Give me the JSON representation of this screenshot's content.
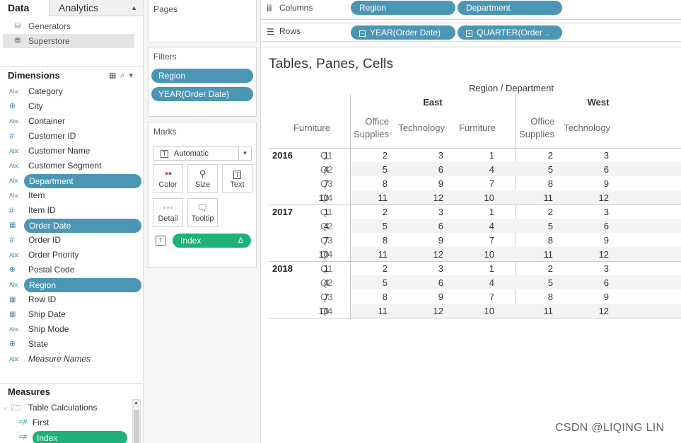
{
  "tabs": {
    "data": "Data",
    "analytics": "Analytics"
  },
  "sources": [
    {
      "label": "Generators",
      "icon": "cylinder-icon"
    },
    {
      "label": "Superstore",
      "icon": "datasource-icon",
      "active": true
    }
  ],
  "dimensions": {
    "title": "Dimensions",
    "fields": [
      {
        "label": "Category",
        "type": "Abc"
      },
      {
        "label": "City",
        "type": "geo"
      },
      {
        "label": "Container",
        "type": "Abc"
      },
      {
        "label": "Customer ID",
        "type": "#"
      },
      {
        "label": "Customer Name",
        "type": "Abc"
      },
      {
        "label": "Customer Segment",
        "type": "Abc"
      },
      {
        "label": "Department",
        "type": "Abc",
        "pill": true
      },
      {
        "label": "Item",
        "type": "Abc"
      },
      {
        "label": "Item ID",
        "type": "#"
      },
      {
        "label": "Order Date",
        "type": "date",
        "pill": true
      },
      {
        "label": "Order ID",
        "type": "#"
      },
      {
        "label": "Order Priority",
        "type": "Abc"
      },
      {
        "label": "Postal Code",
        "type": "geo"
      },
      {
        "label": "Region",
        "type": "Abc",
        "pill": true
      },
      {
        "label": "Row ID",
        "type": "date"
      },
      {
        "label": "Ship Date",
        "type": "date"
      },
      {
        "label": "Ship Mode",
        "type": "Abc"
      },
      {
        "label": "State",
        "type": "geo"
      },
      {
        "label": "Measure Names",
        "type": "Abc",
        "italic": true
      }
    ]
  },
  "measures": {
    "title": "Measures",
    "folder": "Table Calculations",
    "items": [
      {
        "label": "First"
      },
      {
        "label": "Index",
        "pill": true
      }
    ]
  },
  "cards": {
    "pages": "Pages",
    "filters": {
      "title": "Filters",
      "items": [
        "Region",
        "YEAR(Order Date)"
      ]
    },
    "marks": {
      "title": "Marks",
      "type": "Automatic",
      "buttons": [
        "Color",
        "Size",
        "Text",
        "Detail",
        "Tooltip"
      ],
      "field": "Index",
      "field_suffix": "Δ"
    }
  },
  "shelves": {
    "columns": {
      "label": "Columns",
      "pills": [
        "Region",
        "Department"
      ]
    },
    "rows": {
      "label": "Rows",
      "pills": [
        "YEAR(Order Date)",
        "QUARTER(Order .."
      ]
    }
  },
  "view": {
    "title": "Tables, Panes, Cells",
    "header": "Region / Department",
    "regions": [
      "East",
      "West"
    ],
    "departments": [
      [
        "Furniture"
      ],
      [
        "Office",
        "Supplies"
      ],
      [
        "Technology"
      ]
    ],
    "years": [
      "2016",
      "2017",
      "2018"
    ],
    "quarters": [
      "Q1",
      "Q2",
      "Q3",
      "Q4"
    ],
    "rows": [
      [
        1,
        2,
        3,
        1,
        2,
        3
      ],
      [
        4,
        5,
        6,
        4,
        5,
        6
      ],
      [
        7,
        8,
        9,
        7,
        8,
        9
      ],
      [
        10,
        11,
        12,
        10,
        11,
        12
      ]
    ]
  },
  "watermark": "CSDN @LIQING LIN"
}
